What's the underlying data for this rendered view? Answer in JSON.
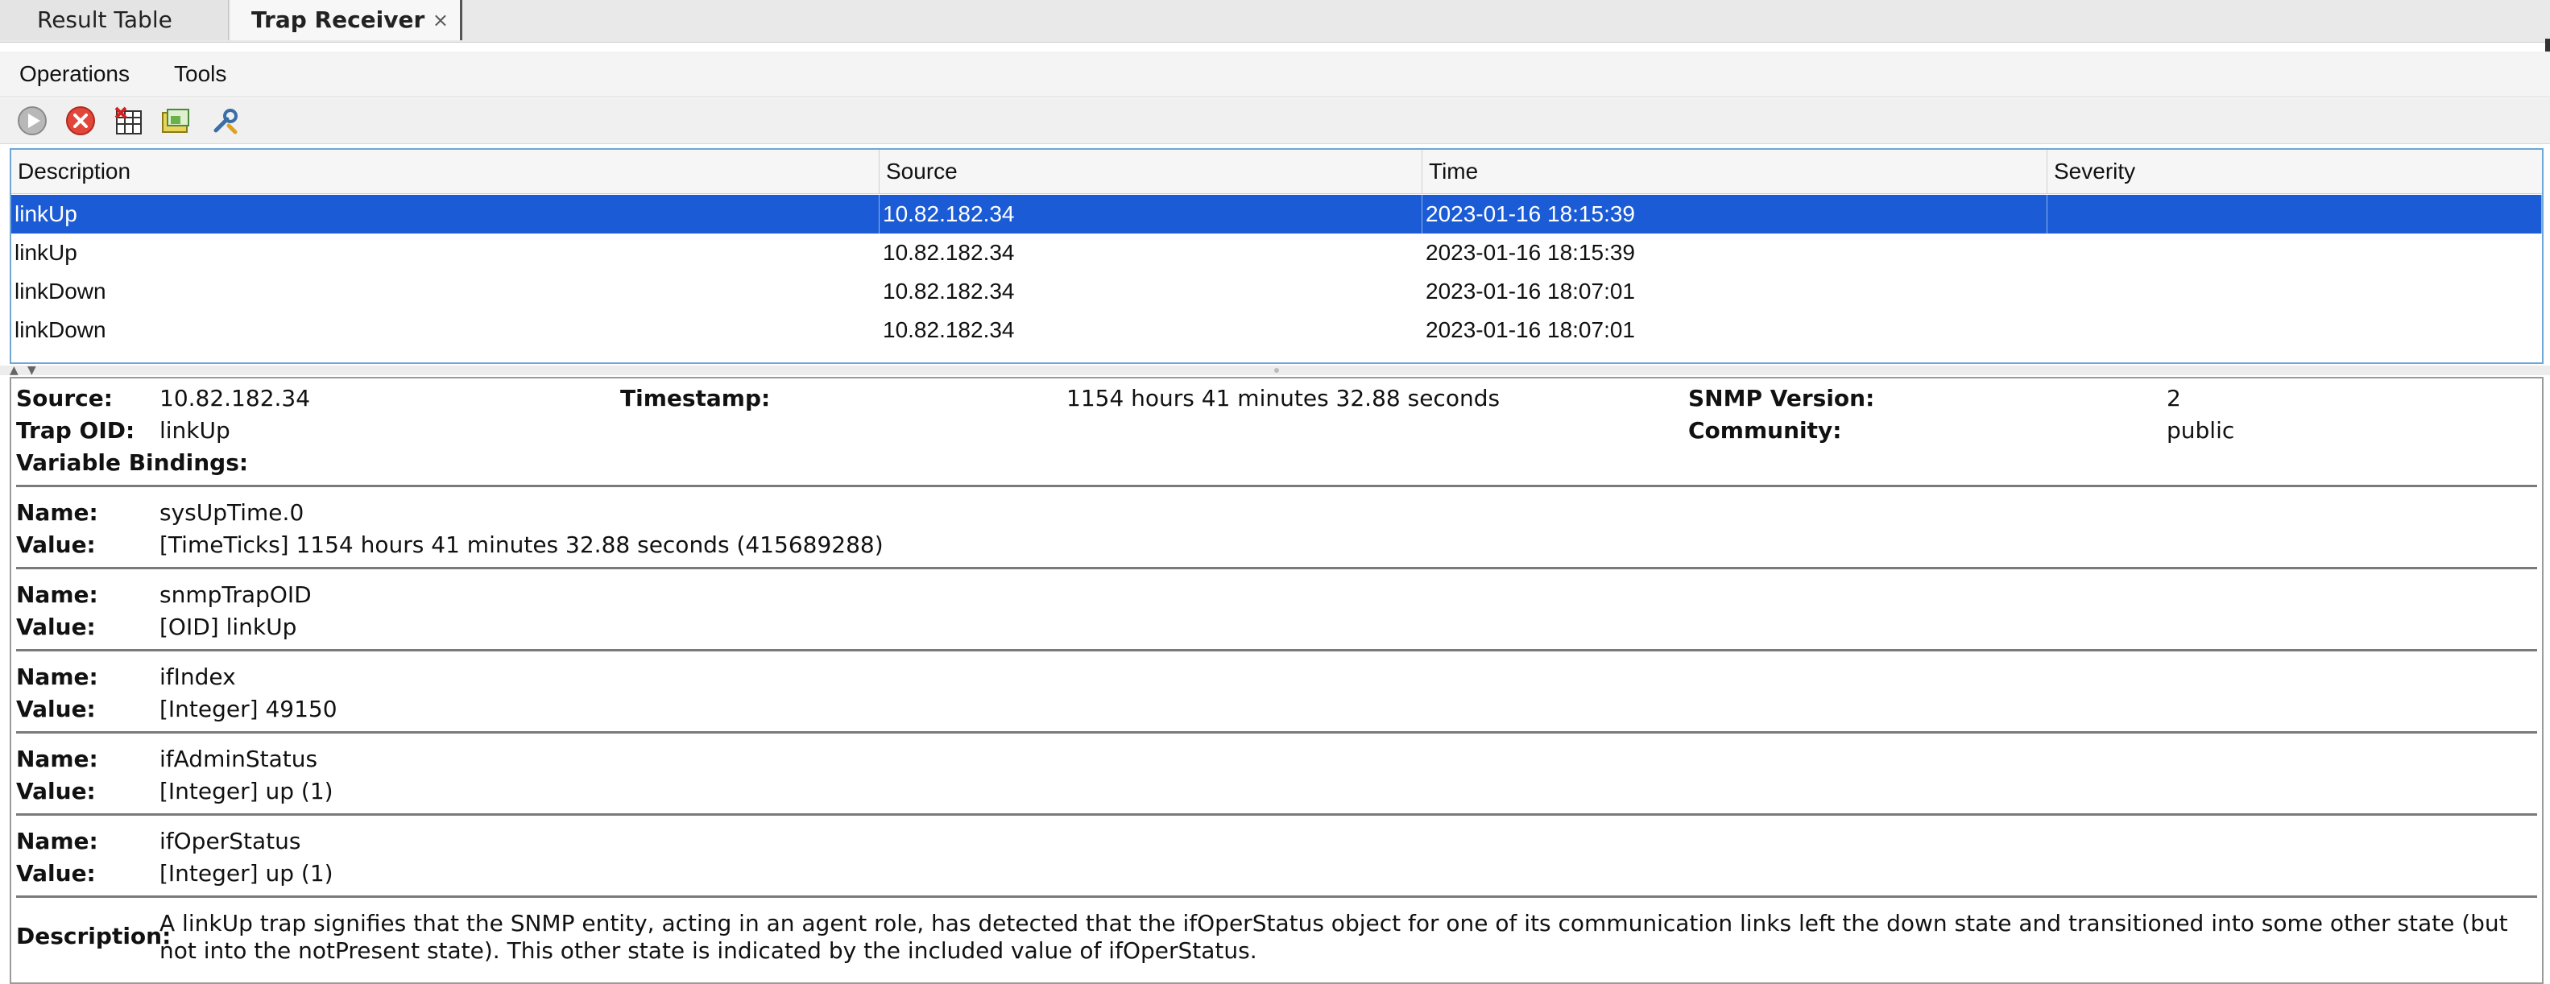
{
  "tabs": [
    {
      "label": "Result Table",
      "active": false
    },
    {
      "label": "Trap Receiver",
      "active": true,
      "close": "×"
    }
  ],
  "menu": [
    "Operations",
    "Tools"
  ],
  "toolbar": {
    "buttons": [
      {
        "icon": "play-icon"
      },
      {
        "icon": "stop-icon"
      },
      {
        "icon": "delete-table-icon"
      },
      {
        "icon": "open-folder-icon"
      },
      {
        "icon": "settings-wrench-icon"
      }
    ]
  },
  "table": {
    "columns": [
      "Description",
      "Source",
      "Time",
      "Severity"
    ],
    "rows": [
      {
        "description": "linkUp",
        "source": "10.82.182.34",
        "time": "2023-01-16 18:15:39",
        "severity": "",
        "selected": true
      },
      {
        "description": "linkUp",
        "source": "10.82.182.34",
        "time": "2023-01-16 18:15:39",
        "severity": ""
      },
      {
        "description": "linkDown",
        "source": "10.82.182.34",
        "time": "2023-01-16 18:07:01",
        "severity": ""
      },
      {
        "description": "linkDown",
        "source": "10.82.182.34",
        "time": "2023-01-16 18:07:01",
        "severity": ""
      }
    ]
  },
  "details": {
    "source_label": "Source:",
    "source_value": "10.82.182.34",
    "timestamp_label": "Timestamp:",
    "timestamp_value": "1154 hours 41 minutes 32.88 seconds",
    "snmp_version_label": "SNMP Version:",
    "snmp_version_value": "2",
    "trap_oid_label": "Trap OID:",
    "trap_oid_value": "linkUp",
    "community_label": "Community:",
    "community_value": "public",
    "bindings_label": "Variable Bindings:",
    "name_label": "Name:",
    "value_label": "Value:",
    "bindings": [
      {
        "name": "sysUpTime.0",
        "value": "[TimeTicks] 1154 hours 41 minutes 32.88 seconds (415689288)"
      },
      {
        "name": "snmpTrapOID",
        "value": "[OID] linkUp"
      },
      {
        "name": "ifIndex",
        "value": "[Integer] 49150"
      },
      {
        "name": "ifAdminStatus",
        "value": "[Integer] up (1)"
      },
      {
        "name": "ifOperStatus",
        "value": "[Integer] up (1)"
      }
    ],
    "description_label": "Description:",
    "description_value": "A linkUp trap signifies that the SNMP entity, acting in an agent role, has detected that the ifOperStatus object for one of its communication links left the down state and transitioned into some other state (but not into the notPresent state). This other state is indicated by the included value of ifOperStatus."
  },
  "colors": {
    "selection": "#1b5cd6",
    "table_border": "#6fa6d8"
  }
}
